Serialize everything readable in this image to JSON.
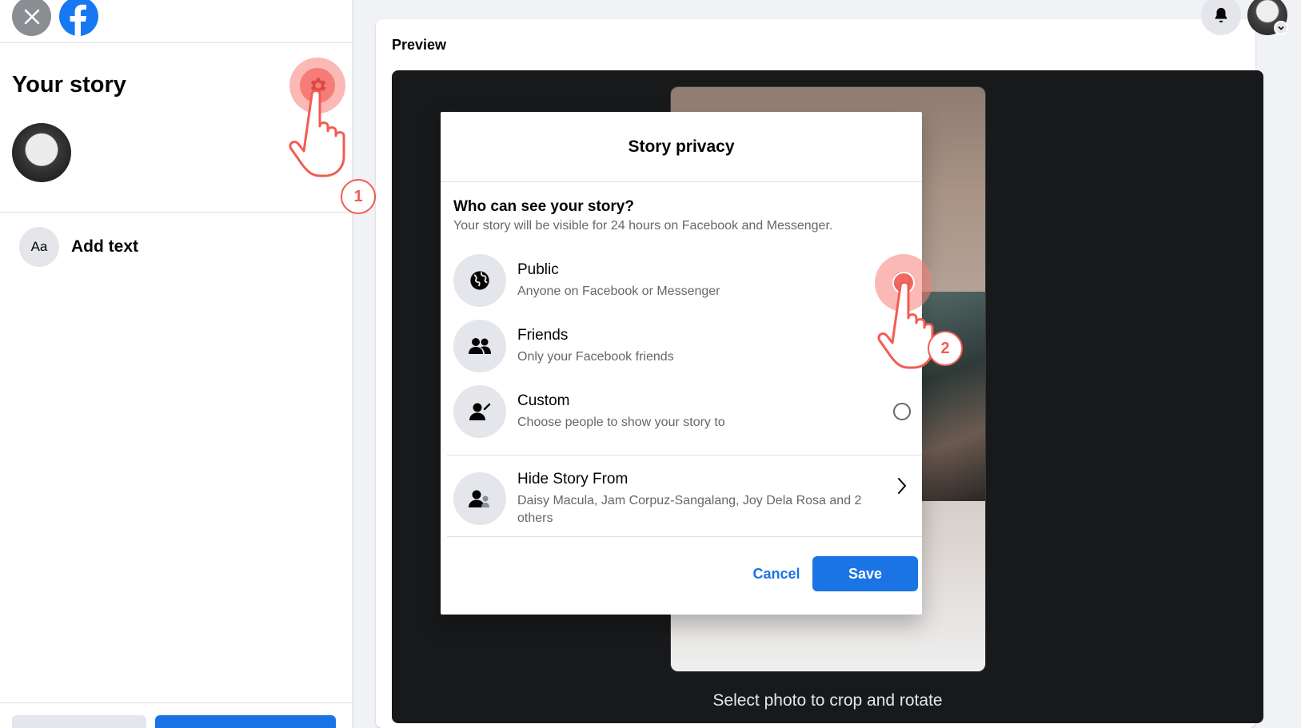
{
  "sidebar": {
    "title": "Your story",
    "add_text_icon": "Aa",
    "add_text_label": "Add text"
  },
  "preview": {
    "label": "Preview",
    "crop_hint": "Select photo to crop and rotate"
  },
  "modal": {
    "title": "Story privacy",
    "question": "Who can see your story?",
    "subtitle": "Your story will be visible for 24 hours on Facebook and Messenger.",
    "options": [
      {
        "title": "Public",
        "desc": "Anyone on Facebook or Messenger",
        "icon": "globe-icon"
      },
      {
        "title": "Friends",
        "desc": "Only your Facebook friends",
        "icon": "friends-icon"
      },
      {
        "title": "Custom",
        "desc": "Choose people to show your story to",
        "icon": "custom-people-icon"
      }
    ],
    "hide_from": {
      "title": "Hide Story From",
      "desc": "Daisy Macula, Jam Corpuz-Sangalang, Joy Dela Rosa and 2 others",
      "icon": "hide-people-icon"
    },
    "cancel_label": "Cancel",
    "save_label": "Save"
  },
  "tutorial": {
    "step1": "1",
    "step2": "2"
  },
  "colors": {
    "brand": "#1877f2",
    "primary_button": "#1b74e4",
    "highlight": "#f25c54"
  }
}
